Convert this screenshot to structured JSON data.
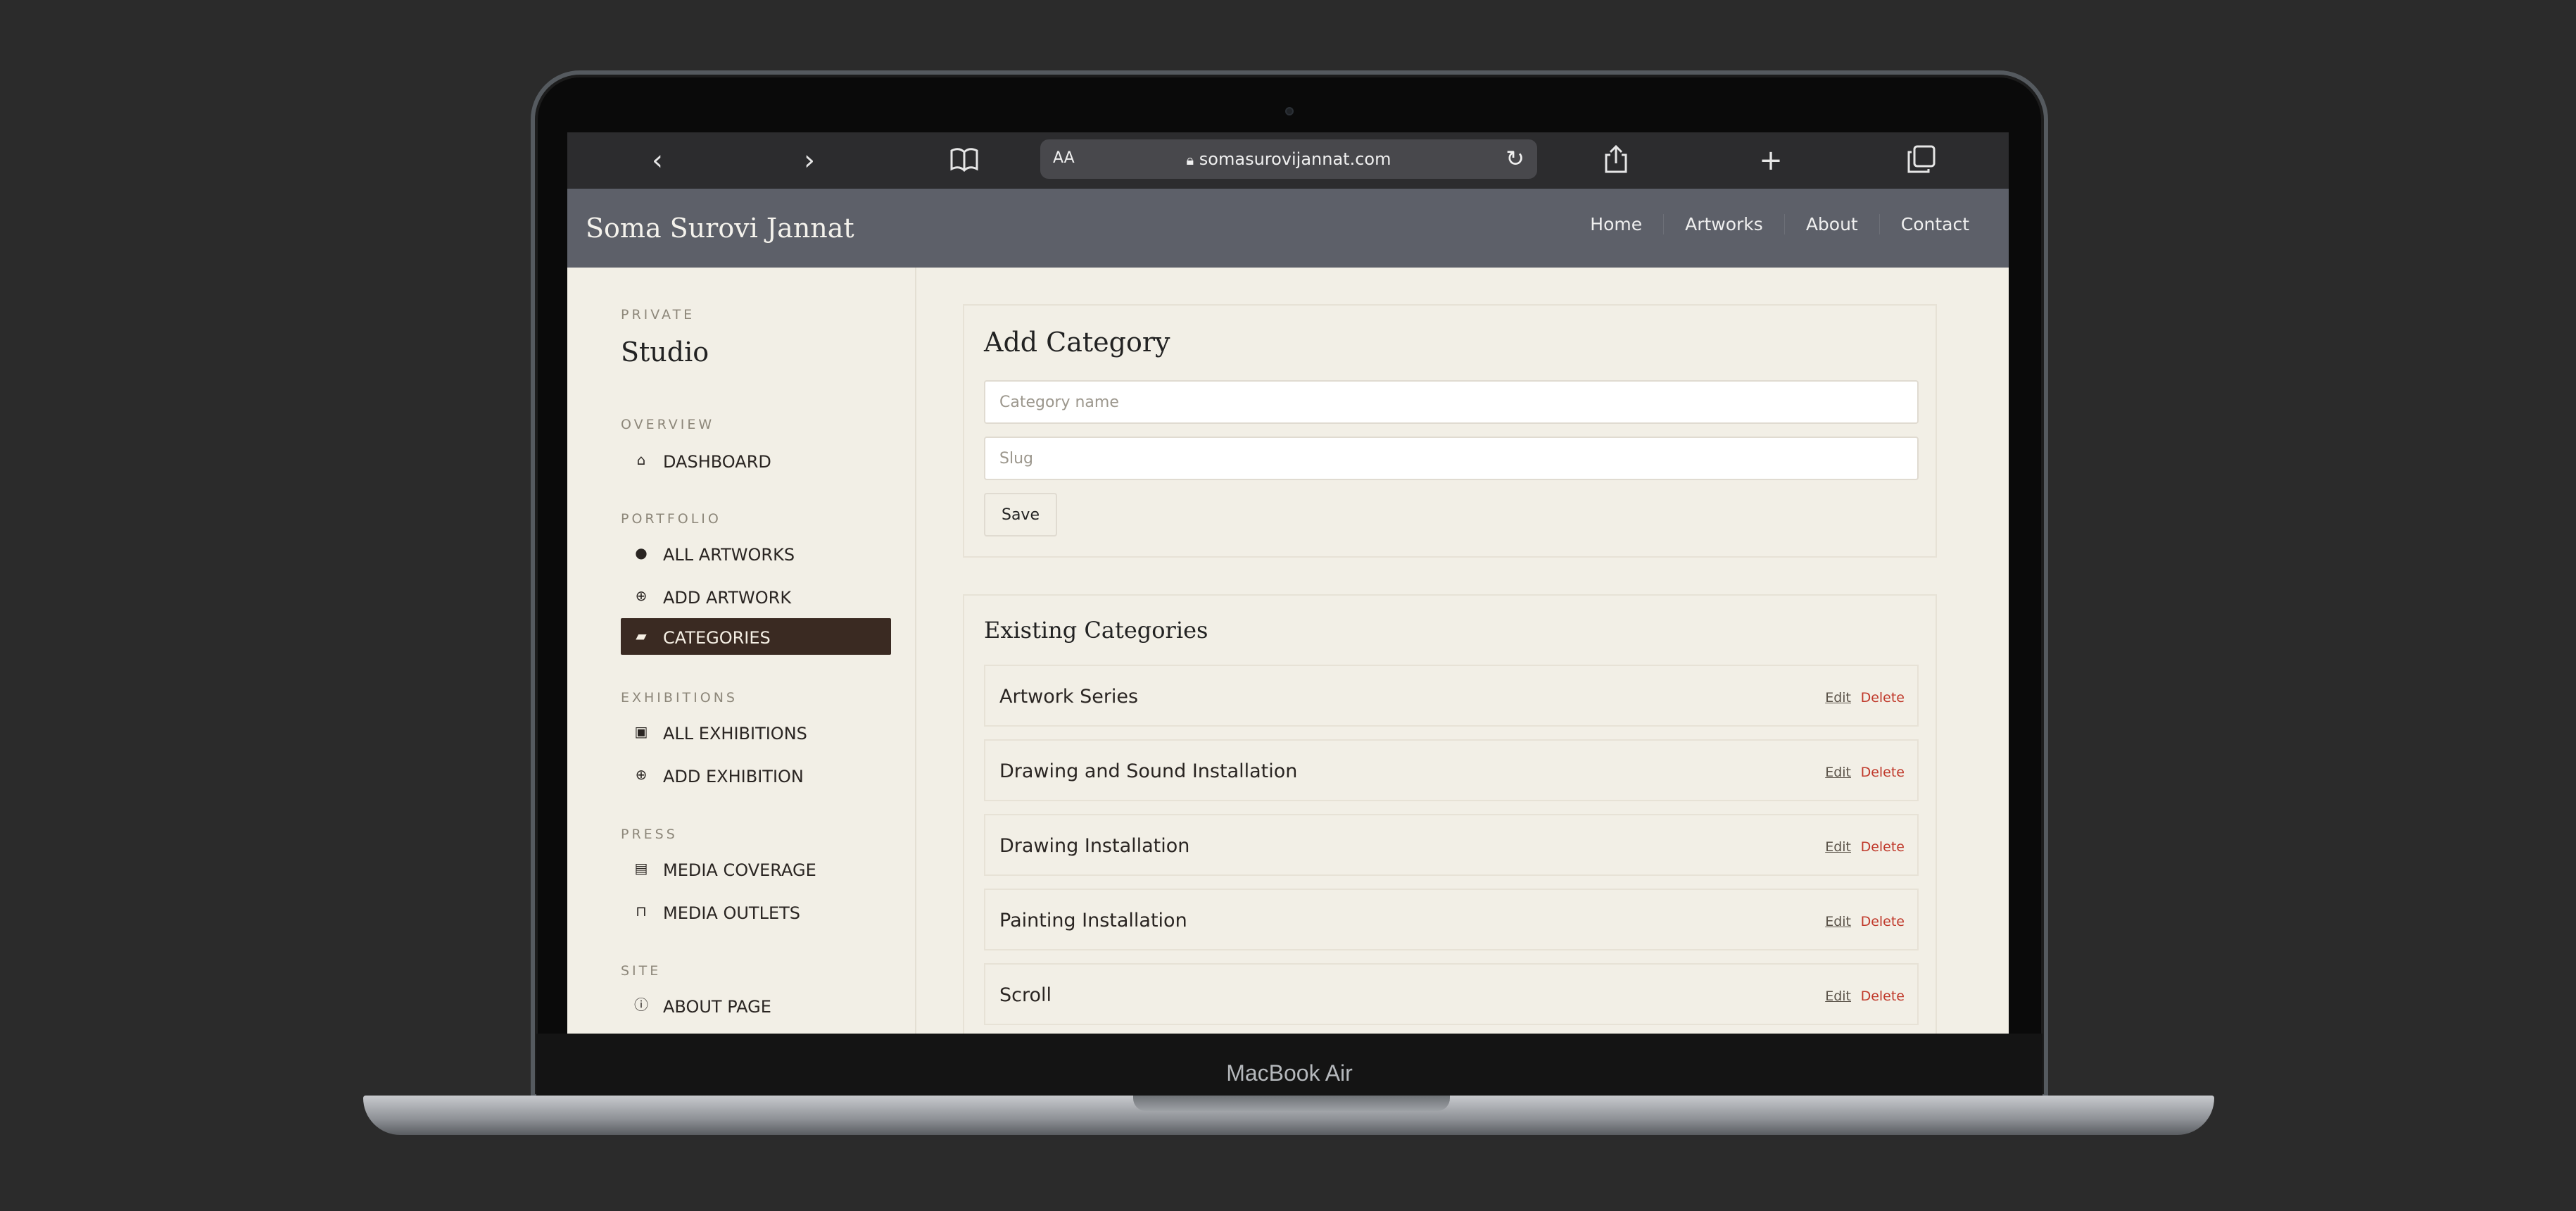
{
  "device": {
    "label": "MacBook Air"
  },
  "browser": {
    "reader_label": "AA",
    "url": "somasurovijannat.com",
    "icons": [
      "back-icon",
      "forward-icon",
      "bookmarks-icon",
      "lock-icon",
      "reload-icon",
      "share-icon",
      "new-tab-icon",
      "tabs-icon"
    ]
  },
  "site": {
    "title": "Soma Surovi Jannat",
    "nav": [
      "Home",
      "Artworks",
      "About",
      "Contact"
    ]
  },
  "sidebar": {
    "private_label": "PRIVATE",
    "studio_title": "Studio",
    "sections": {
      "overview": "OVERVIEW",
      "portfolio": "PORTFOLIO",
      "exhibitions": "EXHIBITIONS",
      "press": "PRESS",
      "site": "SITE"
    },
    "items": {
      "dashboard": "DASHBOARD",
      "all_artworks": "ALL ARTWORKS",
      "add_artwork": "ADD ARTWORK",
      "categories": "CATEGORIES",
      "all_exhibitions": "ALL EXHIBITIONS",
      "add_exhibition": "ADD EXHIBITION",
      "media_coverage": "MEDIA COVERAGE",
      "media_outlets": "MEDIA OUTLETS",
      "about_page": "ABOUT PAGE"
    },
    "active_item": "CATEGORIES",
    "active_color": "#3a2a22"
  },
  "add_category": {
    "title": "Add Category",
    "name_placeholder": "Category name",
    "slug_placeholder": "Slug",
    "save_label": "Save"
  },
  "existing": {
    "title": "Existing Categories",
    "edit_label": "Edit",
    "delete_label": "Delete",
    "delete_color": "#c0392b",
    "categories": [
      "Artwork Series",
      "Drawing and Sound Installation",
      "Drawing Installation",
      "Painting Installation",
      "Scroll"
    ]
  }
}
